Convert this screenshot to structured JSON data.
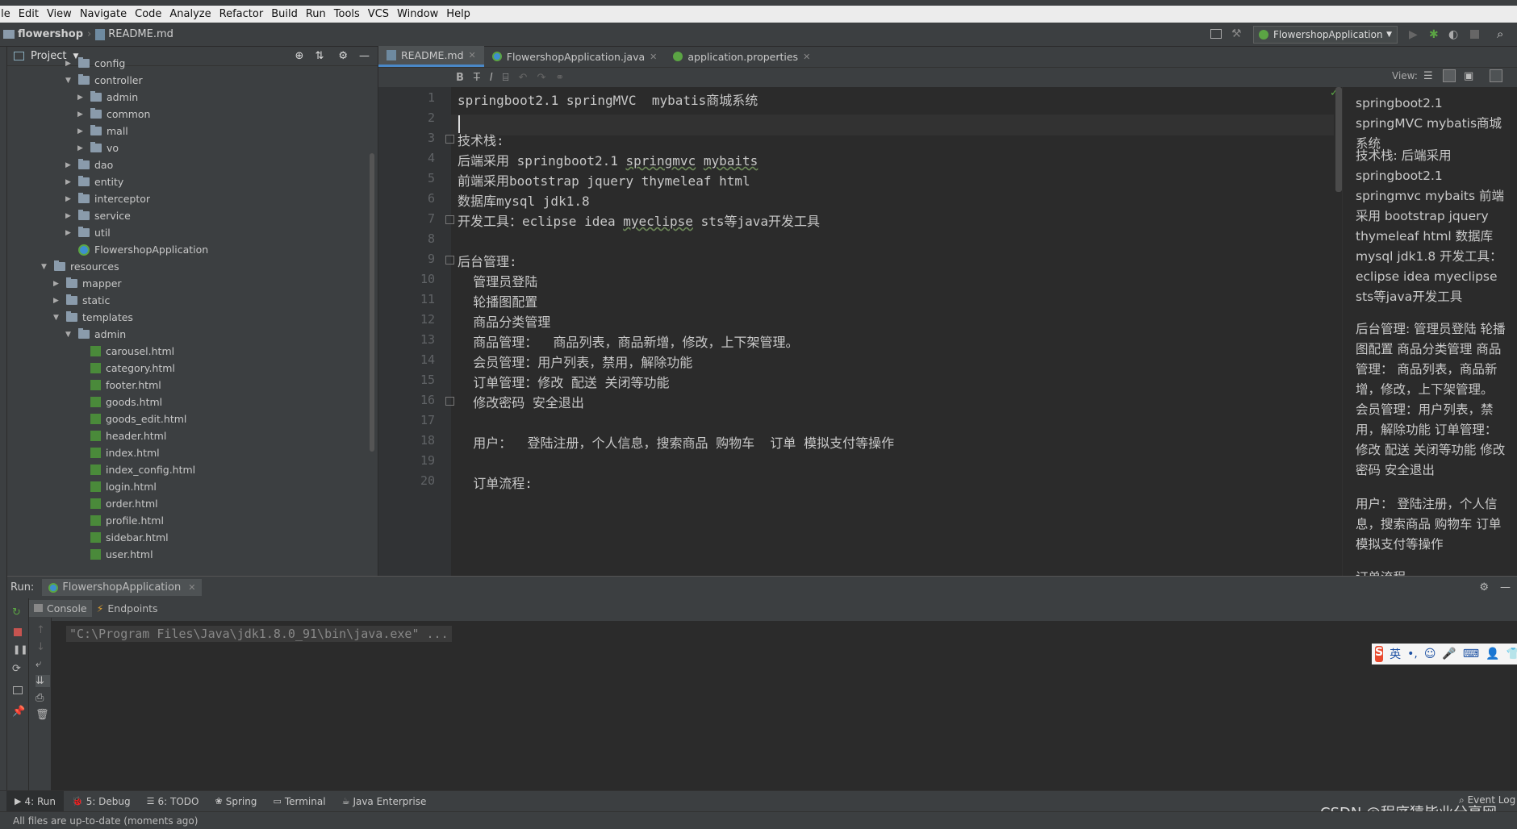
{
  "menu": [
    "File",
    "Edit",
    "View",
    "Navigate",
    "Code",
    "Analyze",
    "Refactor",
    "Build",
    "Run",
    "Tools",
    "VCS",
    "Window",
    "Help"
  ],
  "nav": {
    "project": "flowershop",
    "file": "README.md",
    "run_config": "FlowershopApplication"
  },
  "project_panel": {
    "title": "Project"
  },
  "tree": [
    {
      "label": "config",
      "indent": 0,
      "kind": "folder",
      "arrow": "▶"
    },
    {
      "label": "controller",
      "indent": 0,
      "kind": "folder",
      "arrow": "▼"
    },
    {
      "label": "admin",
      "indent": 1,
      "kind": "folder",
      "arrow": "▶"
    },
    {
      "label": "common",
      "indent": 1,
      "kind": "folder",
      "arrow": "▶"
    },
    {
      "label": "mall",
      "indent": 1,
      "kind": "folder",
      "arrow": "▶"
    },
    {
      "label": "vo",
      "indent": 1,
      "kind": "folder",
      "arrow": "▶"
    },
    {
      "label": "dao",
      "indent": 0,
      "kind": "folder",
      "arrow": "▶"
    },
    {
      "label": "entity",
      "indent": 0,
      "kind": "folder",
      "arrow": "▶"
    },
    {
      "label": "interceptor",
      "indent": 0,
      "kind": "folder",
      "arrow": "▶"
    },
    {
      "label": "service",
      "indent": 0,
      "kind": "folder",
      "arrow": "▶"
    },
    {
      "label": "util",
      "indent": 0,
      "kind": "folder",
      "arrow": "▶"
    },
    {
      "label": "FlowershopApplication",
      "indent": 0,
      "kind": "class",
      "arrow": ""
    },
    {
      "label": "resources",
      "indent": -2,
      "kind": "folder",
      "arrow": "▼"
    },
    {
      "label": "mapper",
      "indent": -1,
      "kind": "folder",
      "arrow": "▶"
    },
    {
      "label": "static",
      "indent": -1,
      "kind": "folder",
      "arrow": "▶"
    },
    {
      "label": "templates",
      "indent": -1,
      "kind": "folder",
      "arrow": "▼"
    },
    {
      "label": "admin",
      "indent": 0,
      "kind": "folder",
      "arrow": "▼"
    },
    {
      "label": "carousel.html",
      "indent": 1,
      "kind": "html",
      "arrow": ""
    },
    {
      "label": "category.html",
      "indent": 1,
      "kind": "html",
      "arrow": ""
    },
    {
      "label": "footer.html",
      "indent": 1,
      "kind": "html",
      "arrow": ""
    },
    {
      "label": "goods.html",
      "indent": 1,
      "kind": "html",
      "arrow": ""
    },
    {
      "label": "goods_edit.html",
      "indent": 1,
      "kind": "html",
      "arrow": ""
    },
    {
      "label": "header.html",
      "indent": 1,
      "kind": "html",
      "arrow": ""
    },
    {
      "label": "index.html",
      "indent": 1,
      "kind": "html",
      "arrow": ""
    },
    {
      "label": "index_config.html",
      "indent": 1,
      "kind": "html",
      "arrow": ""
    },
    {
      "label": "login.html",
      "indent": 1,
      "kind": "html",
      "arrow": ""
    },
    {
      "label": "order.html",
      "indent": 1,
      "kind": "html",
      "arrow": ""
    },
    {
      "label": "profile.html",
      "indent": 1,
      "kind": "html",
      "arrow": ""
    },
    {
      "label": "sidebar.html",
      "indent": 1,
      "kind": "html",
      "arrow": ""
    },
    {
      "label": "user.html",
      "indent": 1,
      "kind": "html",
      "arrow": ""
    }
  ],
  "tabs": [
    {
      "label": "README.md",
      "active": true
    },
    {
      "label": "FlowershopApplication.java",
      "active": false
    },
    {
      "label": "application.properties",
      "active": false
    }
  ],
  "md_toolbar": {
    "view_label": "View:"
  },
  "code_lines": [
    "springboot2.1 springMVC  mybatis商城系统",
    "",
    "技术栈:",
    "后端采用 springboot2.1 springmvc mybaits",
    "前端采用bootstrap jquery thymeleaf html",
    "数据库mysql jdk1.8",
    "开发工具：eclipse idea myeclipse sts等java开发工具",
    "",
    "后台管理:",
    "  管理员登陆",
    "  轮播图配置",
    "  商品分类管理",
    "  商品管理：  商品列表，商品新增，修改，上下架管理。",
    "  会员管理：用户列表，禁用，解除功能",
    "  订单管理：修改 配送 关闭等功能",
    "  修改密码 安全退出",
    "",
    "  用户：  登陆注册，个人信息，搜索商品 购物车  订单 模拟支付等操作",
    "",
    "  订单流程:"
  ],
  "preview": [
    "springboot2.1 springMVC mybatis商城系统",
    "技术栈: 后端采用 springboot2.1 springmvc mybaits 前端采用 bootstrap jquery thymeleaf html 数据库 mysql jdk1.8 开发工具：eclipse idea myeclipse sts等java开发工具",
    "后台管理: 管理员登陆 轮播图配置 商品分类管理 商品管理： 商品列表，商品新增，修改，上下架管理。 会员管理：用户列表，禁用，解除功能 订单管理：修改 配送 关闭等功能 修改密码 安全退出",
    "用户： 登陆注册，个人信息，搜索商品 购物车 订单 模拟支付等操作",
    "订单流程"
  ],
  "run": {
    "label": "Run:",
    "config": "FlowershopApplication",
    "tab_console": "Console",
    "tab_endpoints": "Endpoints"
  },
  "console_line": "\"C:\\Program Files\\Java\\jdk1.8.0_91\\bin\\java.exe\" ...",
  "ime": {
    "lang": "英"
  },
  "bottom_tabs": [
    {
      "label": "4: Run",
      "active": true
    },
    {
      "label": "5: Debug",
      "active": false
    },
    {
      "label": "6: TODO",
      "active": false
    },
    {
      "label": "Spring",
      "active": false
    },
    {
      "label": "Terminal",
      "active": false
    },
    {
      "label": "Java Enterprise",
      "active": false
    }
  ],
  "event_log": "Event Log",
  "status": "All files are up-to-date (moments ago)",
  "watermark": "CSDN @程序猿毕业分享网"
}
